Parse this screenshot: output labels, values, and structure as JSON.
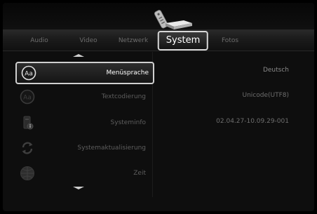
{
  "tabs": [
    {
      "label": "Audio",
      "active": false
    },
    {
      "label": "Video",
      "active": false
    },
    {
      "label": "Netzwerk",
      "active": false
    },
    {
      "label": "System",
      "active": true
    },
    {
      "label": "Fotos",
      "active": false
    }
  ],
  "menu": [
    {
      "label": "Menüsprache",
      "value": "Deutsch",
      "icon": "language-icon",
      "selected": true
    },
    {
      "label": "Textcodierung",
      "value": "Unicode(UTF8)",
      "icon": "text-encoding-icon",
      "selected": false
    },
    {
      "label": "Systeminfo",
      "value": "02.04.27-10.09.29-001",
      "icon": "system-info-icon",
      "selected": false
    },
    {
      "label": "Systemaktualisierung",
      "value": "",
      "icon": "system-update-icon",
      "selected": false
    },
    {
      "label": "Zeit",
      "value": "",
      "icon": "time-icon",
      "selected": false
    }
  ],
  "icons": {
    "language_glyph": "Aa",
    "text_encoding_glyph": "Aa"
  },
  "colors": {
    "background": "#000000",
    "selection_border": "#d0d0d0",
    "inactive_text": "#5e5e5e"
  }
}
